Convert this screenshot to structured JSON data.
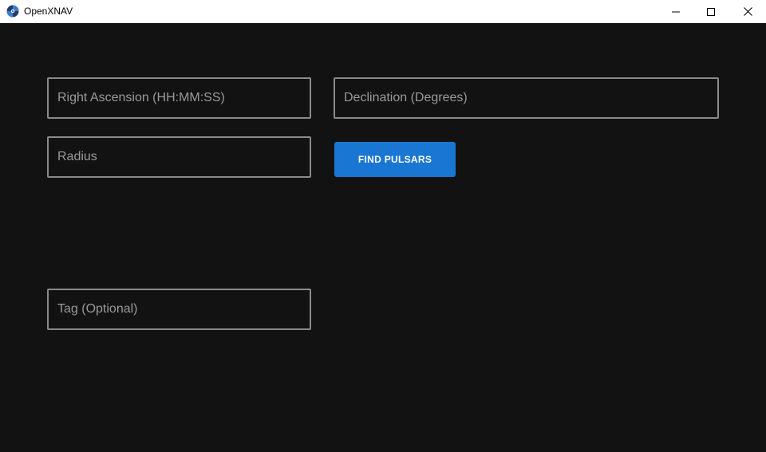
{
  "window": {
    "title": "OpenXNAV",
    "icon": "openxnav-app-icon",
    "controls": {
      "minimize_icon": "minimize-icon",
      "maximize_icon": "maximize-icon",
      "close_icon": "close-icon"
    }
  },
  "form": {
    "right_ascension": {
      "value": "",
      "placeholder": "Right Ascension (HH:MM:SS)"
    },
    "declination": {
      "value": "",
      "placeholder": "Declination (Degrees)"
    },
    "radius": {
      "value": "",
      "placeholder": "Radius"
    },
    "tag": {
      "value": "",
      "placeholder": "Tag (Optional)"
    },
    "find_button_label": "FIND PULSARS"
  },
  "colors": {
    "background": "#121212",
    "field_border": "#8a8a8a",
    "placeholder": "#9a9a9a",
    "primary": "#1976d2",
    "titlebar": "#ffffff"
  }
}
